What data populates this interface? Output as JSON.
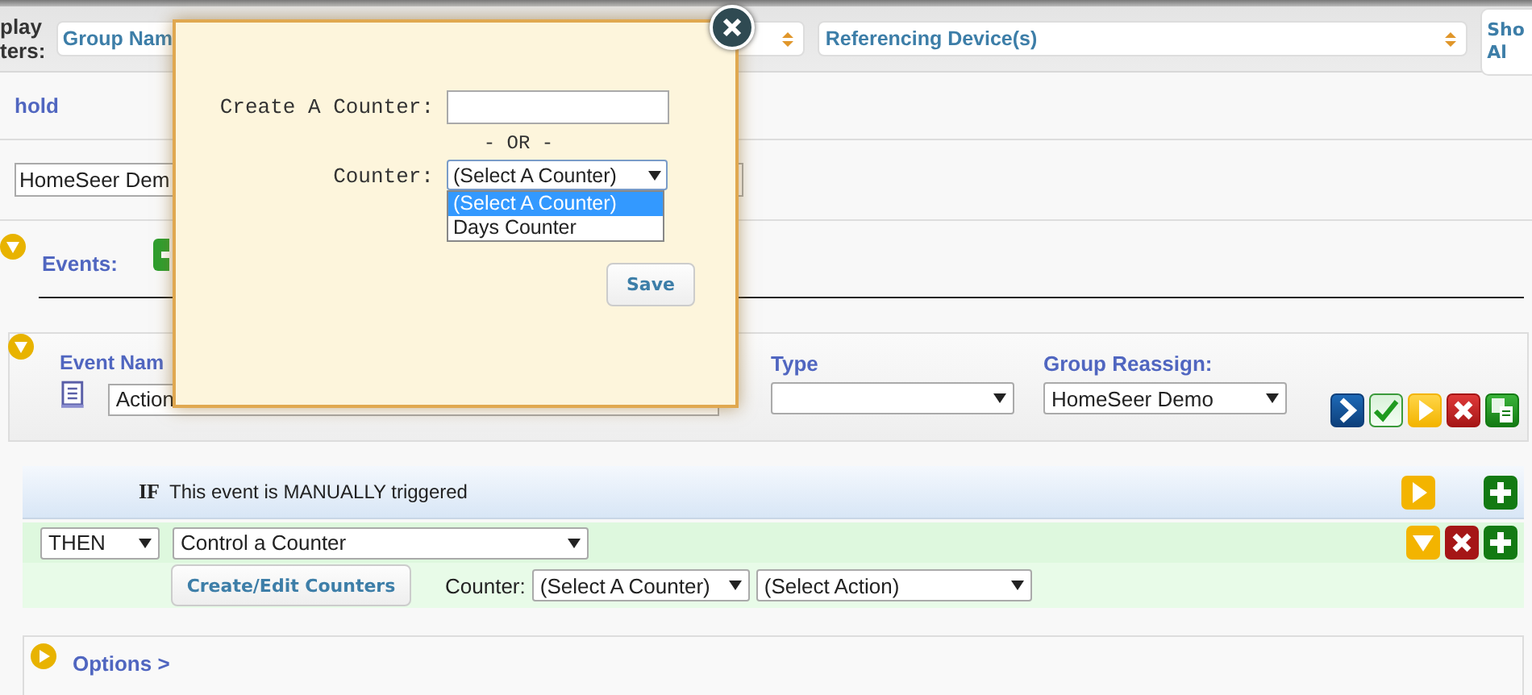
{
  "filter_bar": {
    "label": "play ters:",
    "filters": [
      {
        "value": "Group Nam"
      },
      {
        "value": "Referencing Device(s)"
      }
    ],
    "button": "Sho Al"
  },
  "section_title": "hold",
  "group_field": {
    "value": "HomeSeer Dem"
  },
  "events": {
    "label": "Events:",
    "expanded": true
  },
  "event": {
    "expanded": true,
    "name_label": "Event Nam",
    "name_value": "Action",
    "type_label": "Type",
    "group_label": "Group Reassign:",
    "group_value": "HomeSeer Demo"
  },
  "trigger": {
    "keyword": "IF",
    "text": "This event is MANUALLY triggered"
  },
  "action": {
    "keyword": "THEN",
    "type": "Control a Counter",
    "button": "Create/Edit Counters",
    "counter_label": "Counter:",
    "counter_value": "(Select A Counter)",
    "action_value": "(Select Action)"
  },
  "options": {
    "label": "Options >",
    "expanded": false
  },
  "dialog": {
    "create_label": "Create A Counter:",
    "separator": "- OR -",
    "counter_label": "Counter:",
    "counter_value": "(Select A Counter)",
    "counter_options": [
      {
        "label": "(Select A Counter)",
        "selected": true
      },
      {
        "label": "Days Counter",
        "selected": false
      }
    ],
    "save": "Save"
  }
}
